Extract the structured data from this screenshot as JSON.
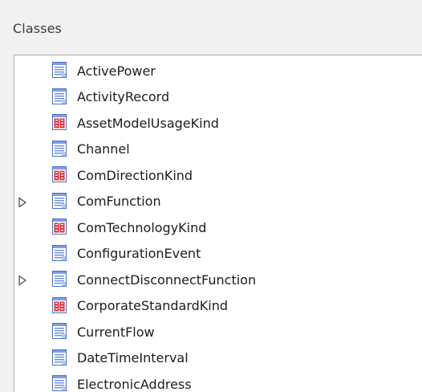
{
  "panel": {
    "title": "Classes"
  },
  "items": [
    {
      "label": "ActivePower",
      "kind": "class",
      "expandable": false
    },
    {
      "label": "ActivityRecord",
      "kind": "class",
      "expandable": false
    },
    {
      "label": "AssetModelUsageKind",
      "kind": "enumeration",
      "expandable": false
    },
    {
      "label": "Channel",
      "kind": "class",
      "expandable": false
    },
    {
      "label": "ComDirectionKind",
      "kind": "enumeration",
      "expandable": false
    },
    {
      "label": "ComFunction",
      "kind": "class",
      "expandable": true
    },
    {
      "label": "ComTechnologyKind",
      "kind": "enumeration",
      "expandable": false
    },
    {
      "label": "ConfigurationEvent",
      "kind": "class",
      "expandable": false
    },
    {
      "label": "ConnectDisconnectFunction",
      "kind": "class",
      "expandable": true
    },
    {
      "label": "CorporateStandardKind",
      "kind": "enumeration",
      "expandable": false
    },
    {
      "label": "CurrentFlow",
      "kind": "class",
      "expandable": false
    },
    {
      "label": "DateTimeInterval",
      "kind": "class",
      "expandable": false
    },
    {
      "label": "ElectronicAddress",
      "kind": "class",
      "expandable": false
    }
  ],
  "icons": {
    "class": "class-icon",
    "enumeration": "enumeration-icon",
    "expander": "expand-triangle-icon"
  },
  "colors": {
    "class_icon_blue": "#4a6fc9",
    "enum_icon_red": "#d8343c"
  }
}
